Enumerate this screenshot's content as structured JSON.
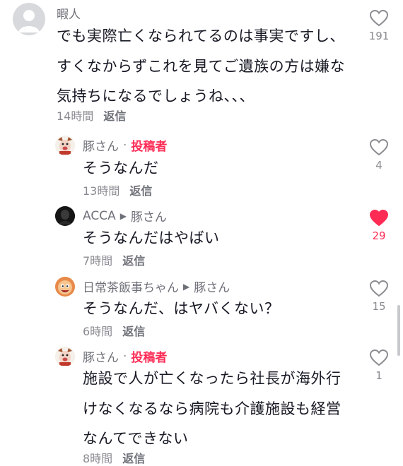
{
  "comments": [
    {
      "user": "暇人",
      "lines": [
        "でも実際亡くなられてるのは事実ですし、",
        "すくなからずこれを見てご遺族の方は嫌な",
        "気持ちになるでしょうね、、、"
      ],
      "time": "14時間",
      "reply_label": "返信",
      "likes": "191",
      "liked": false
    },
    {
      "user": "豚さん",
      "separator": "·",
      "author_tag": "投稿者",
      "lines": [
        "そうなんだ"
      ],
      "time": "13時間",
      "reply_label": "返信",
      "likes": "4",
      "liked": false
    },
    {
      "user": "ACCA",
      "reply_to": "豚さん",
      "lines": [
        "そうなんだはやばい"
      ],
      "time": "7時間",
      "reply_label": "返信",
      "likes": "29",
      "liked": true
    },
    {
      "user": "日常茶飯事ちゃん",
      "reply_to": "豚さん",
      "lines": [
        "そうなんだ、はヤバくない？"
      ],
      "time": "6時間",
      "reply_label": "返信",
      "likes": "15",
      "liked": false
    },
    {
      "user": "豚さん",
      "separator": "·",
      "author_tag": "投稿者",
      "lines": [
        "施設で人が亡くなったら社長が海外行",
        "けなくなるなら病院も介護施設も経営",
        "なんてできない"
      ],
      "time": "8時間",
      "reply_label": "返信",
      "likes": "1",
      "liked": false
    }
  ],
  "colors": {
    "accent": "#fe2c55",
    "secondary_text": "#8a8b91",
    "primary_text": "#161823"
  },
  "icons": {
    "like": "heart-outline-icon",
    "liked": "heart-filled-icon",
    "reply_arrow": "triangle-right-icon"
  }
}
